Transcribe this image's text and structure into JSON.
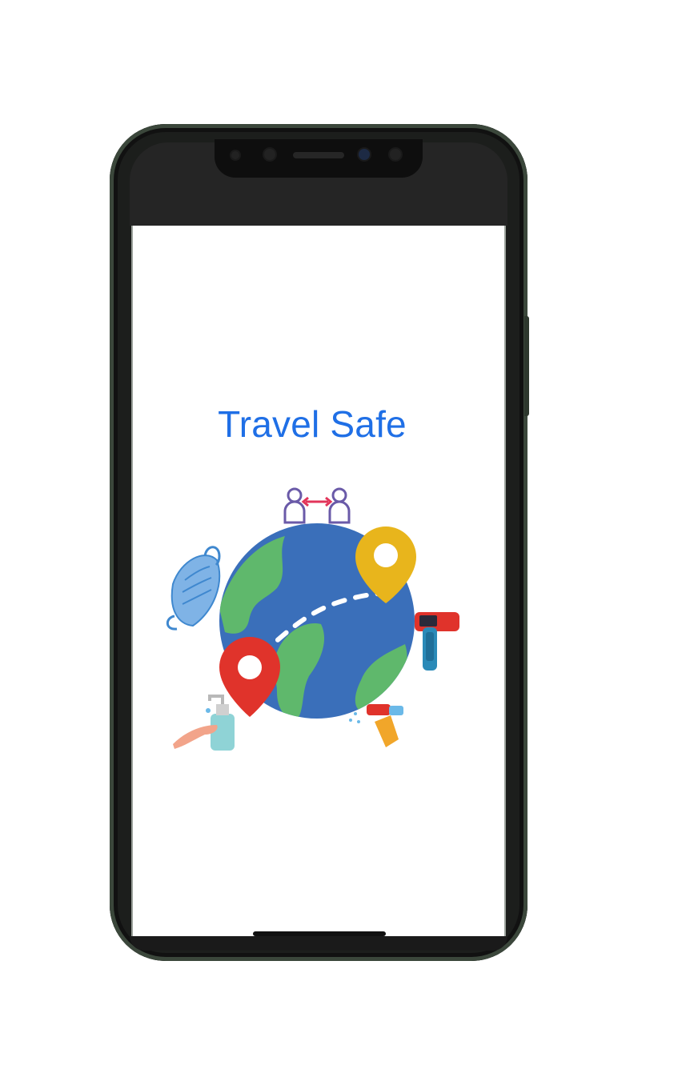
{
  "app": {
    "title": "Travel Safe"
  },
  "colors": {
    "title": "#1f6fe6",
    "globe_ocean": "#3a6fba",
    "globe_land": "#5fb86c",
    "pin_red": "#e0332b",
    "pin_yellow": "#e8b51c",
    "mask": "#7fb3e6"
  },
  "icons": [
    "social-distance-icon",
    "globe-icon",
    "location-pin-icon",
    "face-mask-icon",
    "thermometer-gun-icon",
    "hand-sanitizer-icon",
    "disinfectant-spray-icon"
  ]
}
